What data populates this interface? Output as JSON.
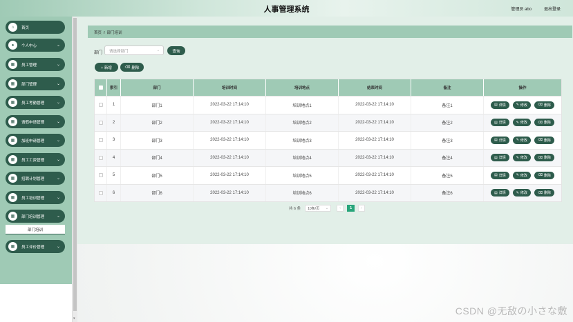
{
  "header": {
    "title": "人事管理系统",
    "user": "管理员 abo",
    "logout": "退出登录"
  },
  "sidebar": {
    "items": [
      {
        "label": "首页",
        "icon": "home-icon",
        "has_children": false
      },
      {
        "label": "个人中心",
        "icon": "user-icon",
        "has_children": true
      },
      {
        "label": "员工管理",
        "icon": "grid-icon",
        "has_children": true
      },
      {
        "label": "部门管理",
        "icon": "grid-icon",
        "has_children": true
      },
      {
        "label": "员工考勤管理",
        "icon": "grid-icon",
        "has_children": true
      },
      {
        "label": "请假申请管理",
        "icon": "grid-icon",
        "has_children": true
      },
      {
        "label": "加班申请管理",
        "icon": "grid-icon",
        "has_children": true
      },
      {
        "label": "员工工资管理",
        "icon": "grid-icon",
        "has_children": true
      },
      {
        "label": "招聘计划管理",
        "icon": "grid-icon",
        "has_children": true
      },
      {
        "label": "员工培训管理",
        "icon": "grid-icon",
        "has_children": true
      },
      {
        "label": "部门培训管理",
        "icon": "grid-icon",
        "has_children": true
      },
      {
        "label": "员工评价管理",
        "icon": "grid-icon",
        "has_children": true
      }
    ],
    "submenu_label": "部门培训"
  },
  "breadcrumb": {
    "home": "首页",
    "separator": "/",
    "current": "部门培训"
  },
  "search": {
    "label": "部门",
    "placeholder": "请选择部门",
    "button": "查询"
  },
  "actions": {
    "add": "+ 新增",
    "delete": "删除"
  },
  "table": {
    "headers": [
      "索引",
      "部门",
      "培训时间",
      "培训地点",
      "结束时间",
      "备注",
      "操作"
    ],
    "rows": [
      {
        "index": "1",
        "dept": "部门1",
        "start": "2022-03-22 17:14:10",
        "place": "培训地点1",
        "end": "2022-03-22 17:14:10",
        "note": "备注1"
      },
      {
        "index": "2",
        "dept": "部门2",
        "start": "2022-03-22 17:14:10",
        "place": "培训地点2",
        "end": "2022-03-22 17:14:10",
        "note": "备注2"
      },
      {
        "index": "3",
        "dept": "部门3",
        "start": "2022-03-22 17:14:10",
        "place": "培训地点3",
        "end": "2022-03-22 17:14:10",
        "note": "备注3"
      },
      {
        "index": "4",
        "dept": "部门4",
        "start": "2022-03-22 17:14:10",
        "place": "培训地点4",
        "end": "2022-03-22 17:14:10",
        "note": "备注4"
      },
      {
        "index": "5",
        "dept": "部门5",
        "start": "2022-03-22 17:14:10",
        "place": "培训地点5",
        "end": "2022-03-22 17:14:10",
        "note": "备注5"
      },
      {
        "index": "6",
        "dept": "部门6",
        "start": "2022-03-22 17:14:10",
        "place": "培训地点6",
        "end": "2022-03-22 17:14:10",
        "note": "备注6"
      }
    ],
    "op_detail": "详情",
    "op_edit": "修改",
    "op_delete": "删除"
  },
  "pager": {
    "total": "共 6 条",
    "page_size": "10条/页",
    "current_page": "1"
  },
  "watermark": "CSDN @无敌の小さな敷",
  "colors": {
    "accent": "#2e5c4c",
    "light_green": "#9fcab5",
    "page_active": "#27a57a"
  }
}
